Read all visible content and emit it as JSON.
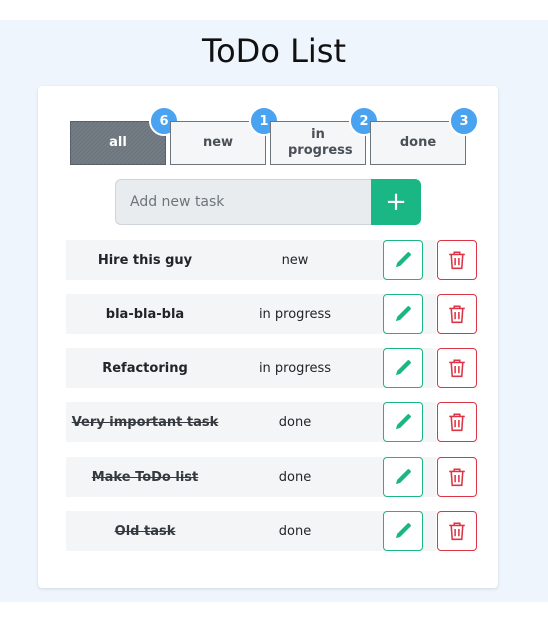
{
  "app": {
    "title": "ToDo List"
  },
  "filters": [
    {
      "label": "all",
      "count": "6",
      "active": true
    },
    {
      "label": "new",
      "count": "1",
      "active": false
    },
    {
      "label": "in progress",
      "count": "2",
      "active": false
    },
    {
      "label": "done",
      "count": "3",
      "active": false
    }
  ],
  "add_task": {
    "placeholder": "Add new task",
    "button_label": "+"
  },
  "tasks": [
    {
      "name": "Hire this guy",
      "status": "new",
      "done": false
    },
    {
      "name": "bla-bla-bla",
      "status": "in progress",
      "done": false
    },
    {
      "name": "Refactoring",
      "status": "in progress",
      "done": false
    },
    {
      "name": "Very important task",
      "status": "done",
      "done": true
    },
    {
      "name": "Make ToDo list",
      "status": "done",
      "done": true
    },
    {
      "name": "Old task",
      "status": "done",
      "done": true
    }
  ],
  "icons": {
    "edit": "pencil-icon",
    "delete": "trash-icon"
  },
  "colors": {
    "accent": "#1ab683",
    "danger": "#dc3545",
    "badge": "#4aa3f0",
    "active_tab": "#6c757d",
    "background": "#eef5fd"
  }
}
